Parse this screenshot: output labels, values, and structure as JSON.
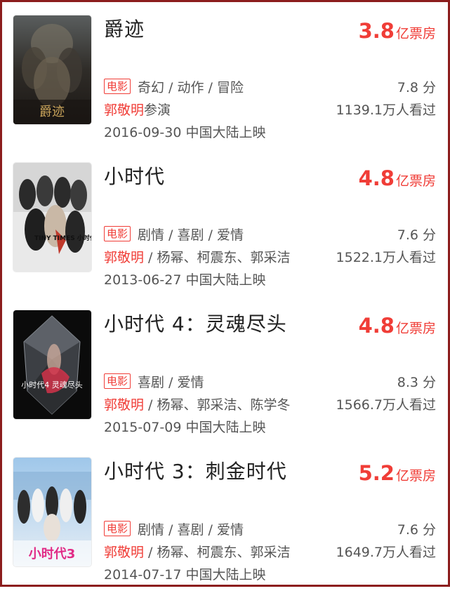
{
  "colors": {
    "accent": "#f03d37",
    "frame": "#8c1d1d",
    "text": "#555555"
  },
  "movies": [
    {
      "title": "爵迹",
      "box_office_num": "3.8",
      "box_office_unit": "亿票房",
      "type_tag": "电影",
      "genres": "奇幻 / 动作 / 冒险",
      "rating": "7.8 分",
      "actor_main": "郭敬明",
      "actor_rest": "参演",
      "viewers": "1139.1万人看过",
      "release": "2016-09-30 中国大陆上映",
      "poster_text": "爵迹"
    },
    {
      "title": "小时代",
      "box_office_num": "4.8",
      "box_office_unit": "亿票房",
      "type_tag": "电影",
      "genres": "剧情 / 喜剧 / 爱情",
      "rating": "7.6 分",
      "actor_main": "郭敬明",
      "actor_rest": " / 杨幂、柯震东、郭采洁",
      "viewers": "1522.1万人看过",
      "release": "2013-06-27 中国大陆上映",
      "poster_text": "TINY TIMES 小时代"
    },
    {
      "title": "小时代 4：灵魂尽头",
      "box_office_num": "4.8",
      "box_office_unit": "亿票房",
      "type_tag": "电影",
      "genres": "喜剧 / 爱情",
      "rating": "8.3 分",
      "actor_main": "郭敬明",
      "actor_rest": " / 杨幂、郭采洁、陈学冬",
      "viewers": "1566.7万人看过",
      "release": "2015-07-09 中国大陆上映",
      "poster_text": "小时代4 灵魂尽头"
    },
    {
      "title": "小时代 3：刺金时代",
      "box_office_num": "5.2",
      "box_office_unit": "亿票房",
      "type_tag": "电影",
      "genres": "剧情 / 喜剧 / 爱情",
      "rating": "7.6 分",
      "actor_main": "郭敬明",
      "actor_rest": " / 杨幂、柯震东、郭采洁",
      "viewers": "1649.7万人看过",
      "release": "2014-07-17 中国大陆上映",
      "poster_text": "小时代3"
    }
  ]
}
